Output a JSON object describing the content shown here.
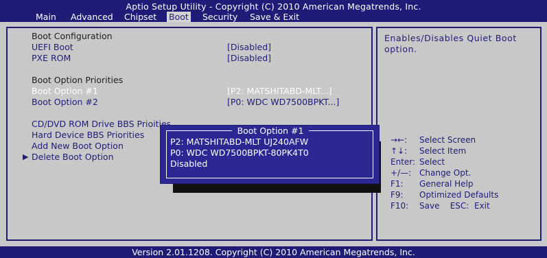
{
  "title": "Aptio Setup Utility - Copyright (C) 2010 American Megatrends, Inc.",
  "tabs": [
    "Main",
    "Advanced",
    "Chipset",
    "Boot",
    "Security",
    "Save & Exit"
  ],
  "active_tab": "Boot",
  "left": {
    "boot_config_heading": "Boot Configuration",
    "uefi_boot_label": "UEFI Boot",
    "uefi_boot_value": "[Disabled]",
    "pxe_rom_label": "PXE ROM",
    "pxe_rom_value": "[Disabled]",
    "priorities_heading": "Boot Option Priorities",
    "boot_option1_label": "Boot Option #1",
    "boot_option1_value": "[P2:  MATSHITABD-MLT...]",
    "boot_option2_label": "Boot Option #2",
    "boot_option2_value": "[P0:  WDC WD7500BPKT...]",
    "cdrom_bbs_label": "CD/DVD ROM Drive BBS Prio",
    "cdrom_bbs_tail": "ities",
    "hdd_bbs_label": "Hard Device BBS Priorities",
    "add_boot_label": "Add New Boot Option",
    "delete_boot_label": "Delete Boot Option"
  },
  "popup": {
    "title": "Boot Option #1",
    "options": [
      "P2:  MATSHITABD-MLT UJ240AFW",
      "P0:  WDC WD7500BPKT-80PK4T0",
      "Disabled"
    ]
  },
  "right": {
    "help_line1": "Enables/Disables Quiet Boot",
    "help_line2": "option.",
    "keys": [
      {
        "key": "→←:",
        "desc": "Select Screen"
      },
      {
        "key": "↑↓:",
        "desc": "Select Item"
      },
      {
        "key": "Enter:",
        "desc": "Select"
      },
      {
        "key": "+/—:",
        "desc": "Change Opt."
      },
      {
        "key": "F1:",
        "desc": "General Help"
      },
      {
        "key": "F9:",
        "desc": "Optimized Defaults"
      },
      {
        "key": "F10:",
        "desc": "Save    ESC:  Exit"
      }
    ]
  },
  "footer": "Version 2.01.1208. Copyright (C) 2010 American Megatrends, Inc.",
  "colors": {
    "bg": "#1f1c78",
    "panel": "#c8c8c8",
    "popup": "#2b2894"
  }
}
